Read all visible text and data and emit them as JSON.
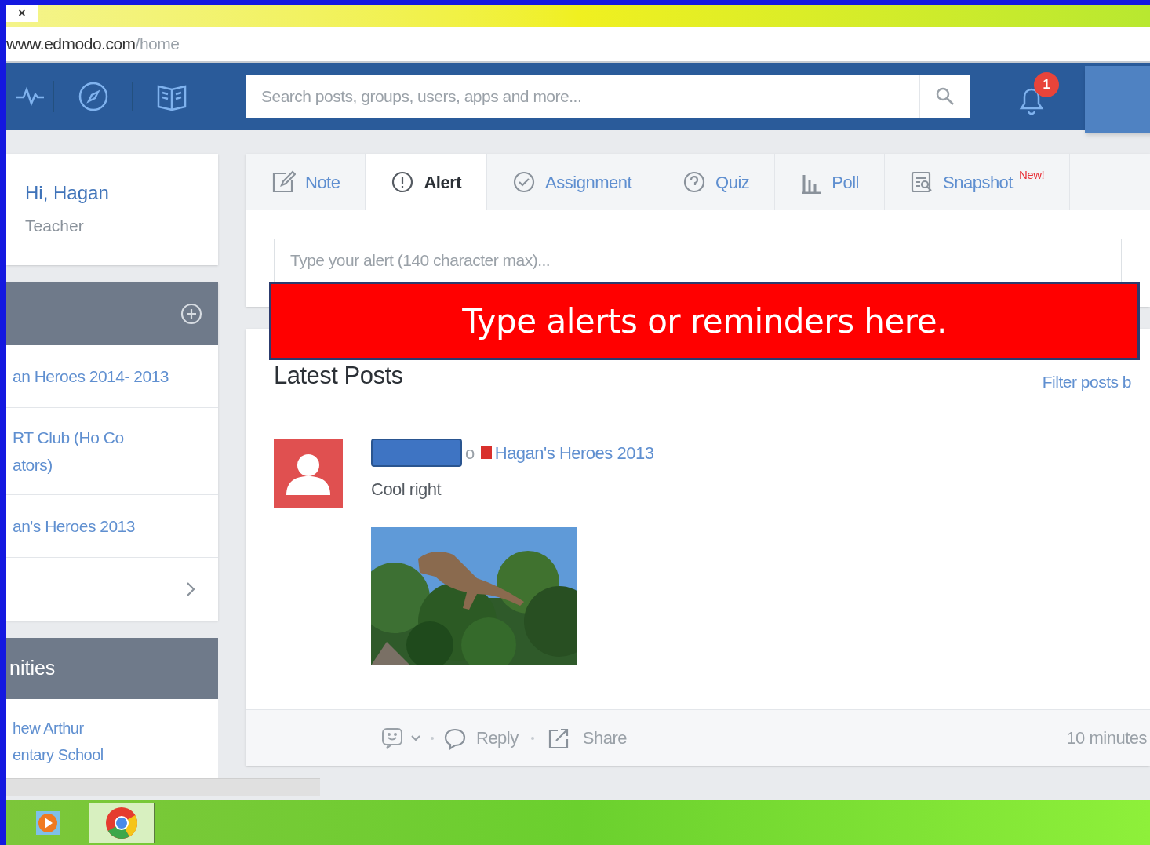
{
  "browser": {
    "tab_close": "×",
    "url_host": "www.edmodo.com",
    "url_path": "/home"
  },
  "navbar": {
    "search_placeholder": "Search posts, groups, users, apps and more...",
    "notification_count": "1"
  },
  "sidebar": {
    "greeting": "Hi, Hagan",
    "role": "Teacher",
    "groups": [
      {
        "lines": [
          "an Heroes 2014- 2013"
        ]
      },
      {
        "lines": [
          "RT Club (Ho Co",
          "ators)"
        ]
      },
      {
        "lines": [
          "an's Heroes 2013"
        ]
      }
    ],
    "communities_header": "nities",
    "communities": [
      {
        "lines": [
          "hew Arthur",
          "entary School"
        ]
      }
    ]
  },
  "composer": {
    "tabs": [
      {
        "label": "Note",
        "selected": false
      },
      {
        "label": "Alert",
        "selected": true
      },
      {
        "label": "Assignment",
        "selected": false
      },
      {
        "label": "Quiz",
        "selected": false
      },
      {
        "label": "Poll",
        "selected": false
      },
      {
        "label": "Snapshot",
        "selected": false,
        "badge": "New!"
      }
    ],
    "placeholder": "Type your alert (140 character max)..."
  },
  "annotation": "Type alerts or reminders here.",
  "feed": {
    "title": "Latest Posts",
    "filter": "Filter posts b",
    "post": {
      "author_fragment": "o",
      "group": "Hagan's Heroes 2013",
      "color": "#d9302c",
      "message": "Cool right",
      "image": {
        "kind": "picture"
      },
      "actions": [
        "Reply",
        "Share"
      ],
      "time": "10 minutes"
    }
  }
}
